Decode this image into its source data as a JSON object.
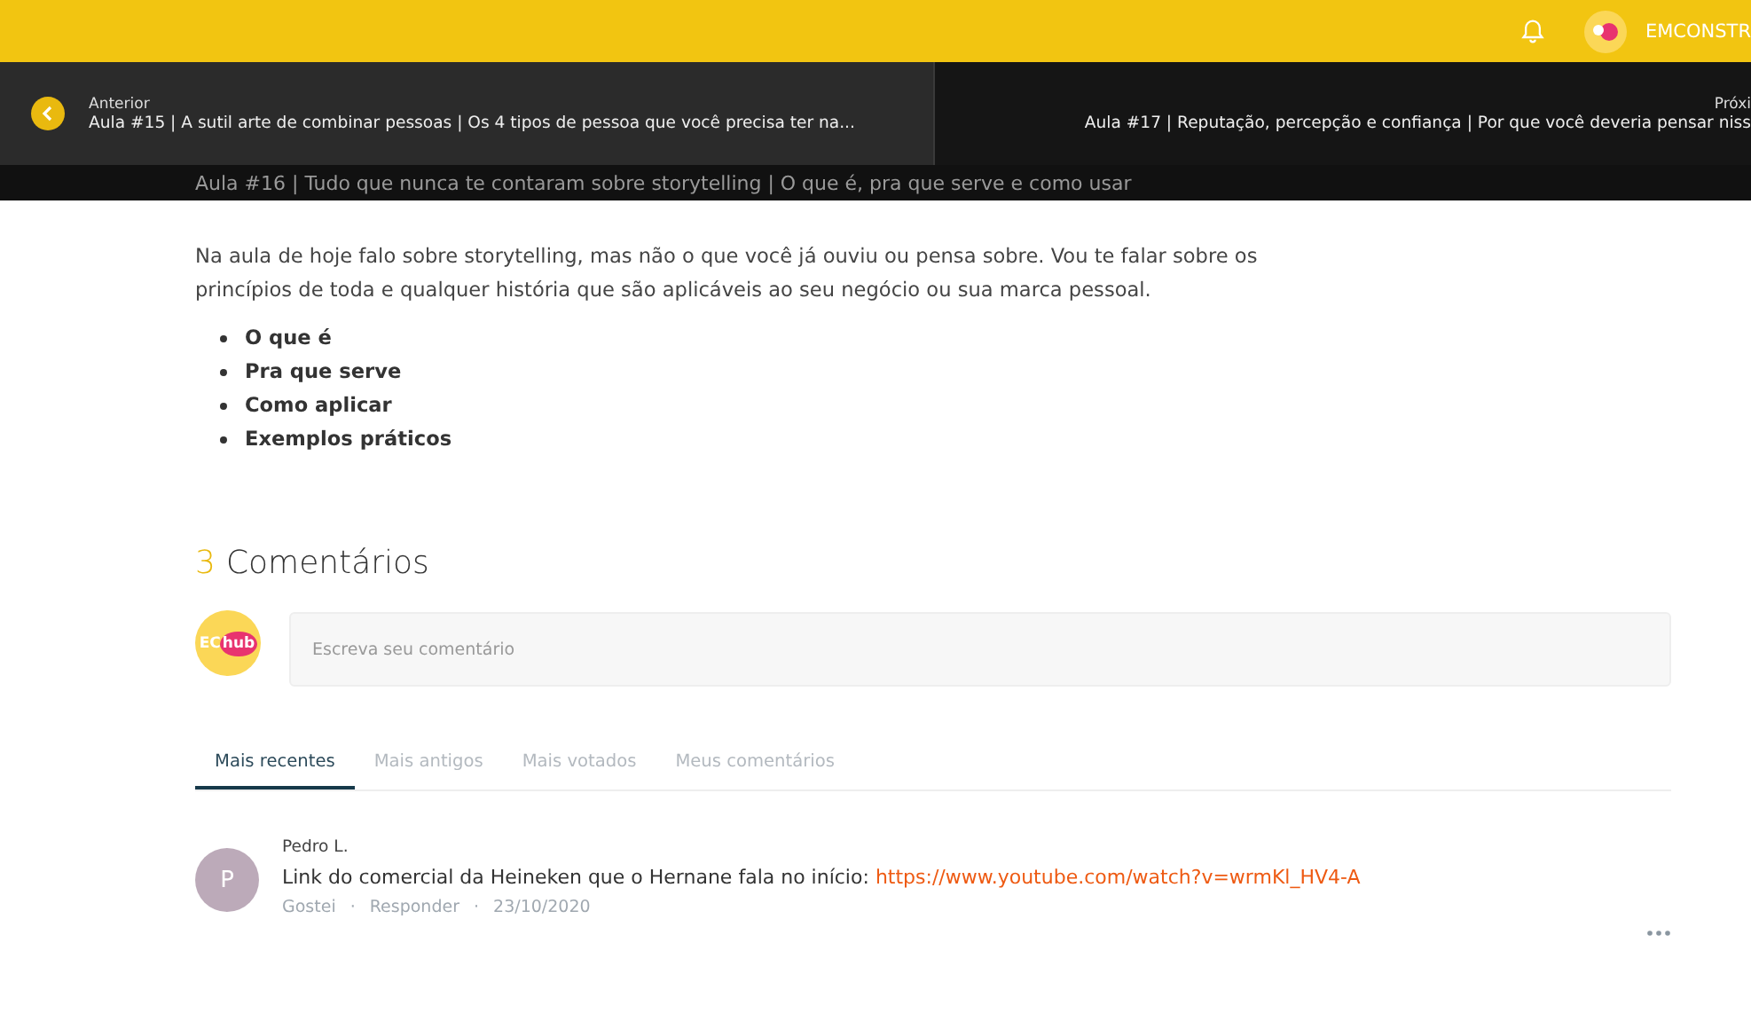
{
  "topbar": {
    "user_name": "EMCONSTR"
  },
  "lesson_title": "Aula #16 | Tudo que nunca te contaram sobre storytelling | O que é, pra que serve e como usar",
  "previous": {
    "label": "Anterior",
    "title": "Aula #15 | A sutil arte de combinar pessoas | Os 4 tipos de pessoa que você precisa ter na..."
  },
  "next": {
    "label": "Próxi",
    "title": "Aula #17 | Reputação, percepção e confiança | Por que você deveria pensar niss"
  },
  "description": "Na aula de hoje falo sobre storytelling, mas não o que você já ouviu ou pensa sobre. Vou te falar sobre os princípios de toda e qualquer história que são aplicáveis ao seu negócio ou sua marca pessoal.",
  "topics": [
    "O que é",
    "Pra que serve",
    "Como aplicar",
    "Exemplos práticos"
  ],
  "comments_section": {
    "count": "3",
    "heading": "Comentários",
    "avatar_text": [
      "EC",
      "hub"
    ],
    "placeholder": "Escreva seu comentário"
  },
  "tabs": [
    {
      "label": "Mais recentes",
      "selected": true
    },
    {
      "label": "Mais antigos",
      "selected": false
    },
    {
      "label": "Mais votados",
      "selected": false
    },
    {
      "label": "Meus comentários",
      "selected": false
    }
  ],
  "comments": [
    {
      "avatar_letter": "P",
      "author": "Pedro L.",
      "text": "Link do comercial da Heineken que o Hernane fala no início: ",
      "link": "https://www.youtube.com/watch?v=wrmKl_HV4-A",
      "like": "Gostei",
      "reply": "Responder",
      "date": "23/10/2020",
      "separator": "·"
    }
  ]
}
